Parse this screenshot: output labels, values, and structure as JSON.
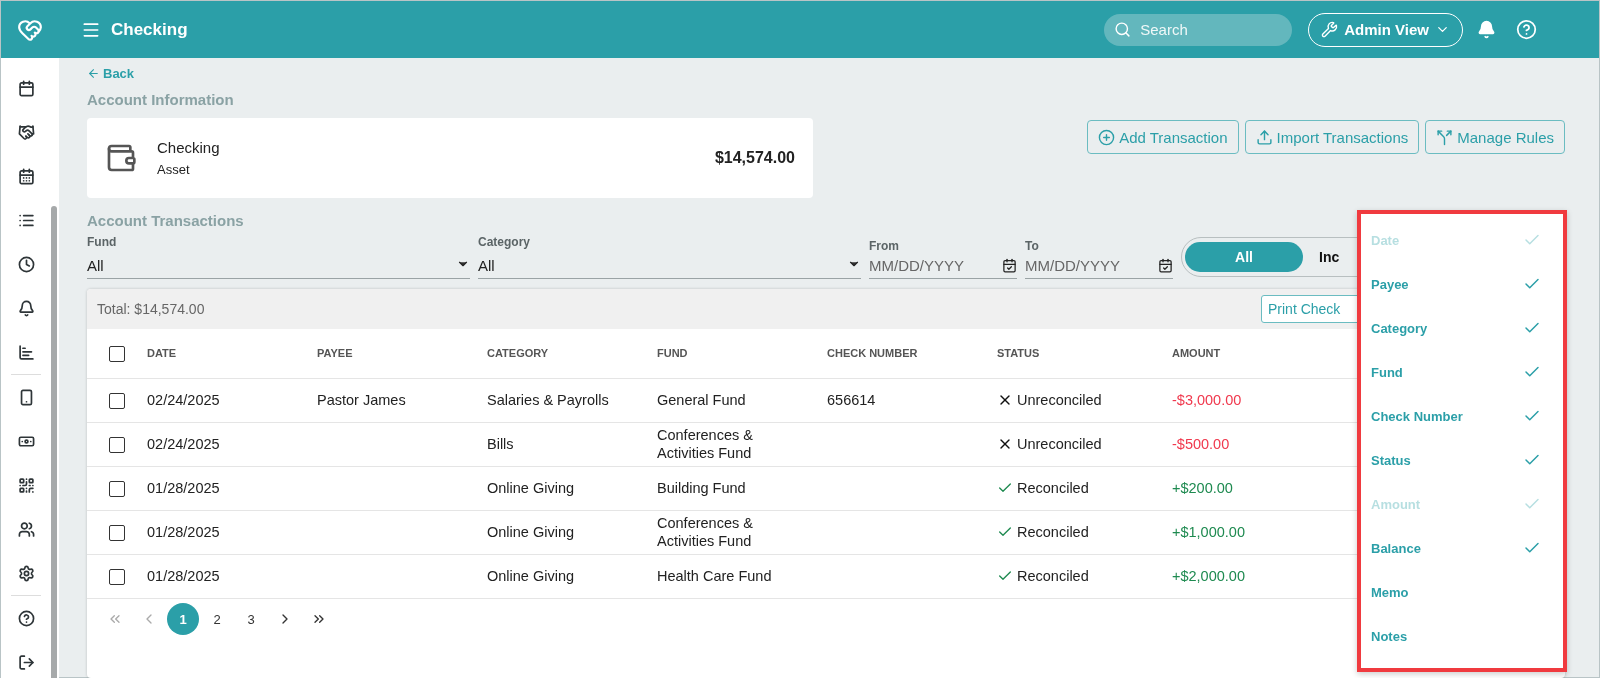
{
  "header": {
    "title": "Checking",
    "search_placeholder": "Search",
    "view_button": "Admin View"
  },
  "back_link": "Back",
  "account_info": {
    "heading": "Account Information",
    "name": "Checking",
    "type": "Asset",
    "balance": "$14,574.00"
  },
  "actions": [
    "Add Transaction",
    "Import Transactions",
    "Manage Rules"
  ],
  "transactions_heading": "Account Transactions",
  "filters": [
    {
      "kind": "select",
      "label": "Fund",
      "value": "All"
    },
    {
      "kind": "select",
      "label": "Category",
      "value": "All"
    },
    {
      "kind": "date",
      "label": "From",
      "placeholder": "MM/DD/YYYY"
    },
    {
      "kind": "date",
      "label": "To",
      "placeholder": "MM/DD/YYYY"
    }
  ],
  "toggle": [
    {
      "label": "All",
      "selected": true
    },
    {
      "label": "Inc",
      "selected": false
    }
  ],
  "table": {
    "total_label": "Total:",
    "total_value": "$14,574.00",
    "print_button": "Print Check",
    "select_all": {
      "checked": false
    },
    "columns": [
      "DATE",
      "PAYEE",
      "CATEGORY",
      "FUND",
      "CHECK NUMBER",
      "STATUS",
      "AMOUNT"
    ],
    "rows": [
      {
        "checked": false,
        "date": "02/24/2025",
        "payee": "Pastor James",
        "category": "Salaries & Payrolls",
        "fund": "General Fund",
        "check_number": "656614",
        "reconciled": false,
        "status": "Unreconciled",
        "amount": "-$3,000.00",
        "kind": "debit"
      },
      {
        "checked": false,
        "date": "02/24/2025",
        "category": "Bills",
        "fund": "Conferences & Activities Fund",
        "reconciled": false,
        "status": "Unreconciled",
        "amount": "-$500.00",
        "kind": "debit"
      },
      {
        "checked": false,
        "date": "01/28/2025",
        "category": "Online Giving",
        "fund": "Building Fund",
        "reconciled": true,
        "status": "Reconciled",
        "amount": "+$200.00",
        "kind": "credit"
      },
      {
        "checked": false,
        "date": "01/28/2025",
        "category": "Online Giving",
        "fund": "Conferences & Activities Fund",
        "reconciled": true,
        "status": "Reconciled",
        "amount": "+$1,000.00",
        "kind": "credit"
      },
      {
        "checked": false,
        "date": "01/28/2025",
        "category": "Online Giving",
        "fund": "Health Care Fund",
        "reconciled": true,
        "status": "Reconciled",
        "amount": "+$2,000.00",
        "kind": "credit"
      }
    ],
    "pages": [
      {
        "label": "1",
        "selected": true
      },
      {
        "label": "2",
        "selected": false
      },
      {
        "label": "3",
        "selected": false
      }
    ]
  },
  "column_menu": [
    {
      "label": "Date",
      "checked": true,
      "disabled": true
    },
    {
      "label": "Payee",
      "checked": true,
      "disabled": false
    },
    {
      "label": "Category",
      "checked": true,
      "disabled": false
    },
    {
      "label": "Fund",
      "checked": true,
      "disabled": false
    },
    {
      "label": "Check Number",
      "checked": true,
      "disabled": false
    },
    {
      "label": "Status",
      "checked": true,
      "disabled": false
    },
    {
      "label": "Amount",
      "checked": true,
      "disabled": true
    },
    {
      "label": "Balance",
      "checked": true,
      "disabled": false
    },
    {
      "label": "Memo",
      "checked": false,
      "disabled": false
    },
    {
      "label": "Notes",
      "checked": false,
      "disabled": false
    }
  ]
}
